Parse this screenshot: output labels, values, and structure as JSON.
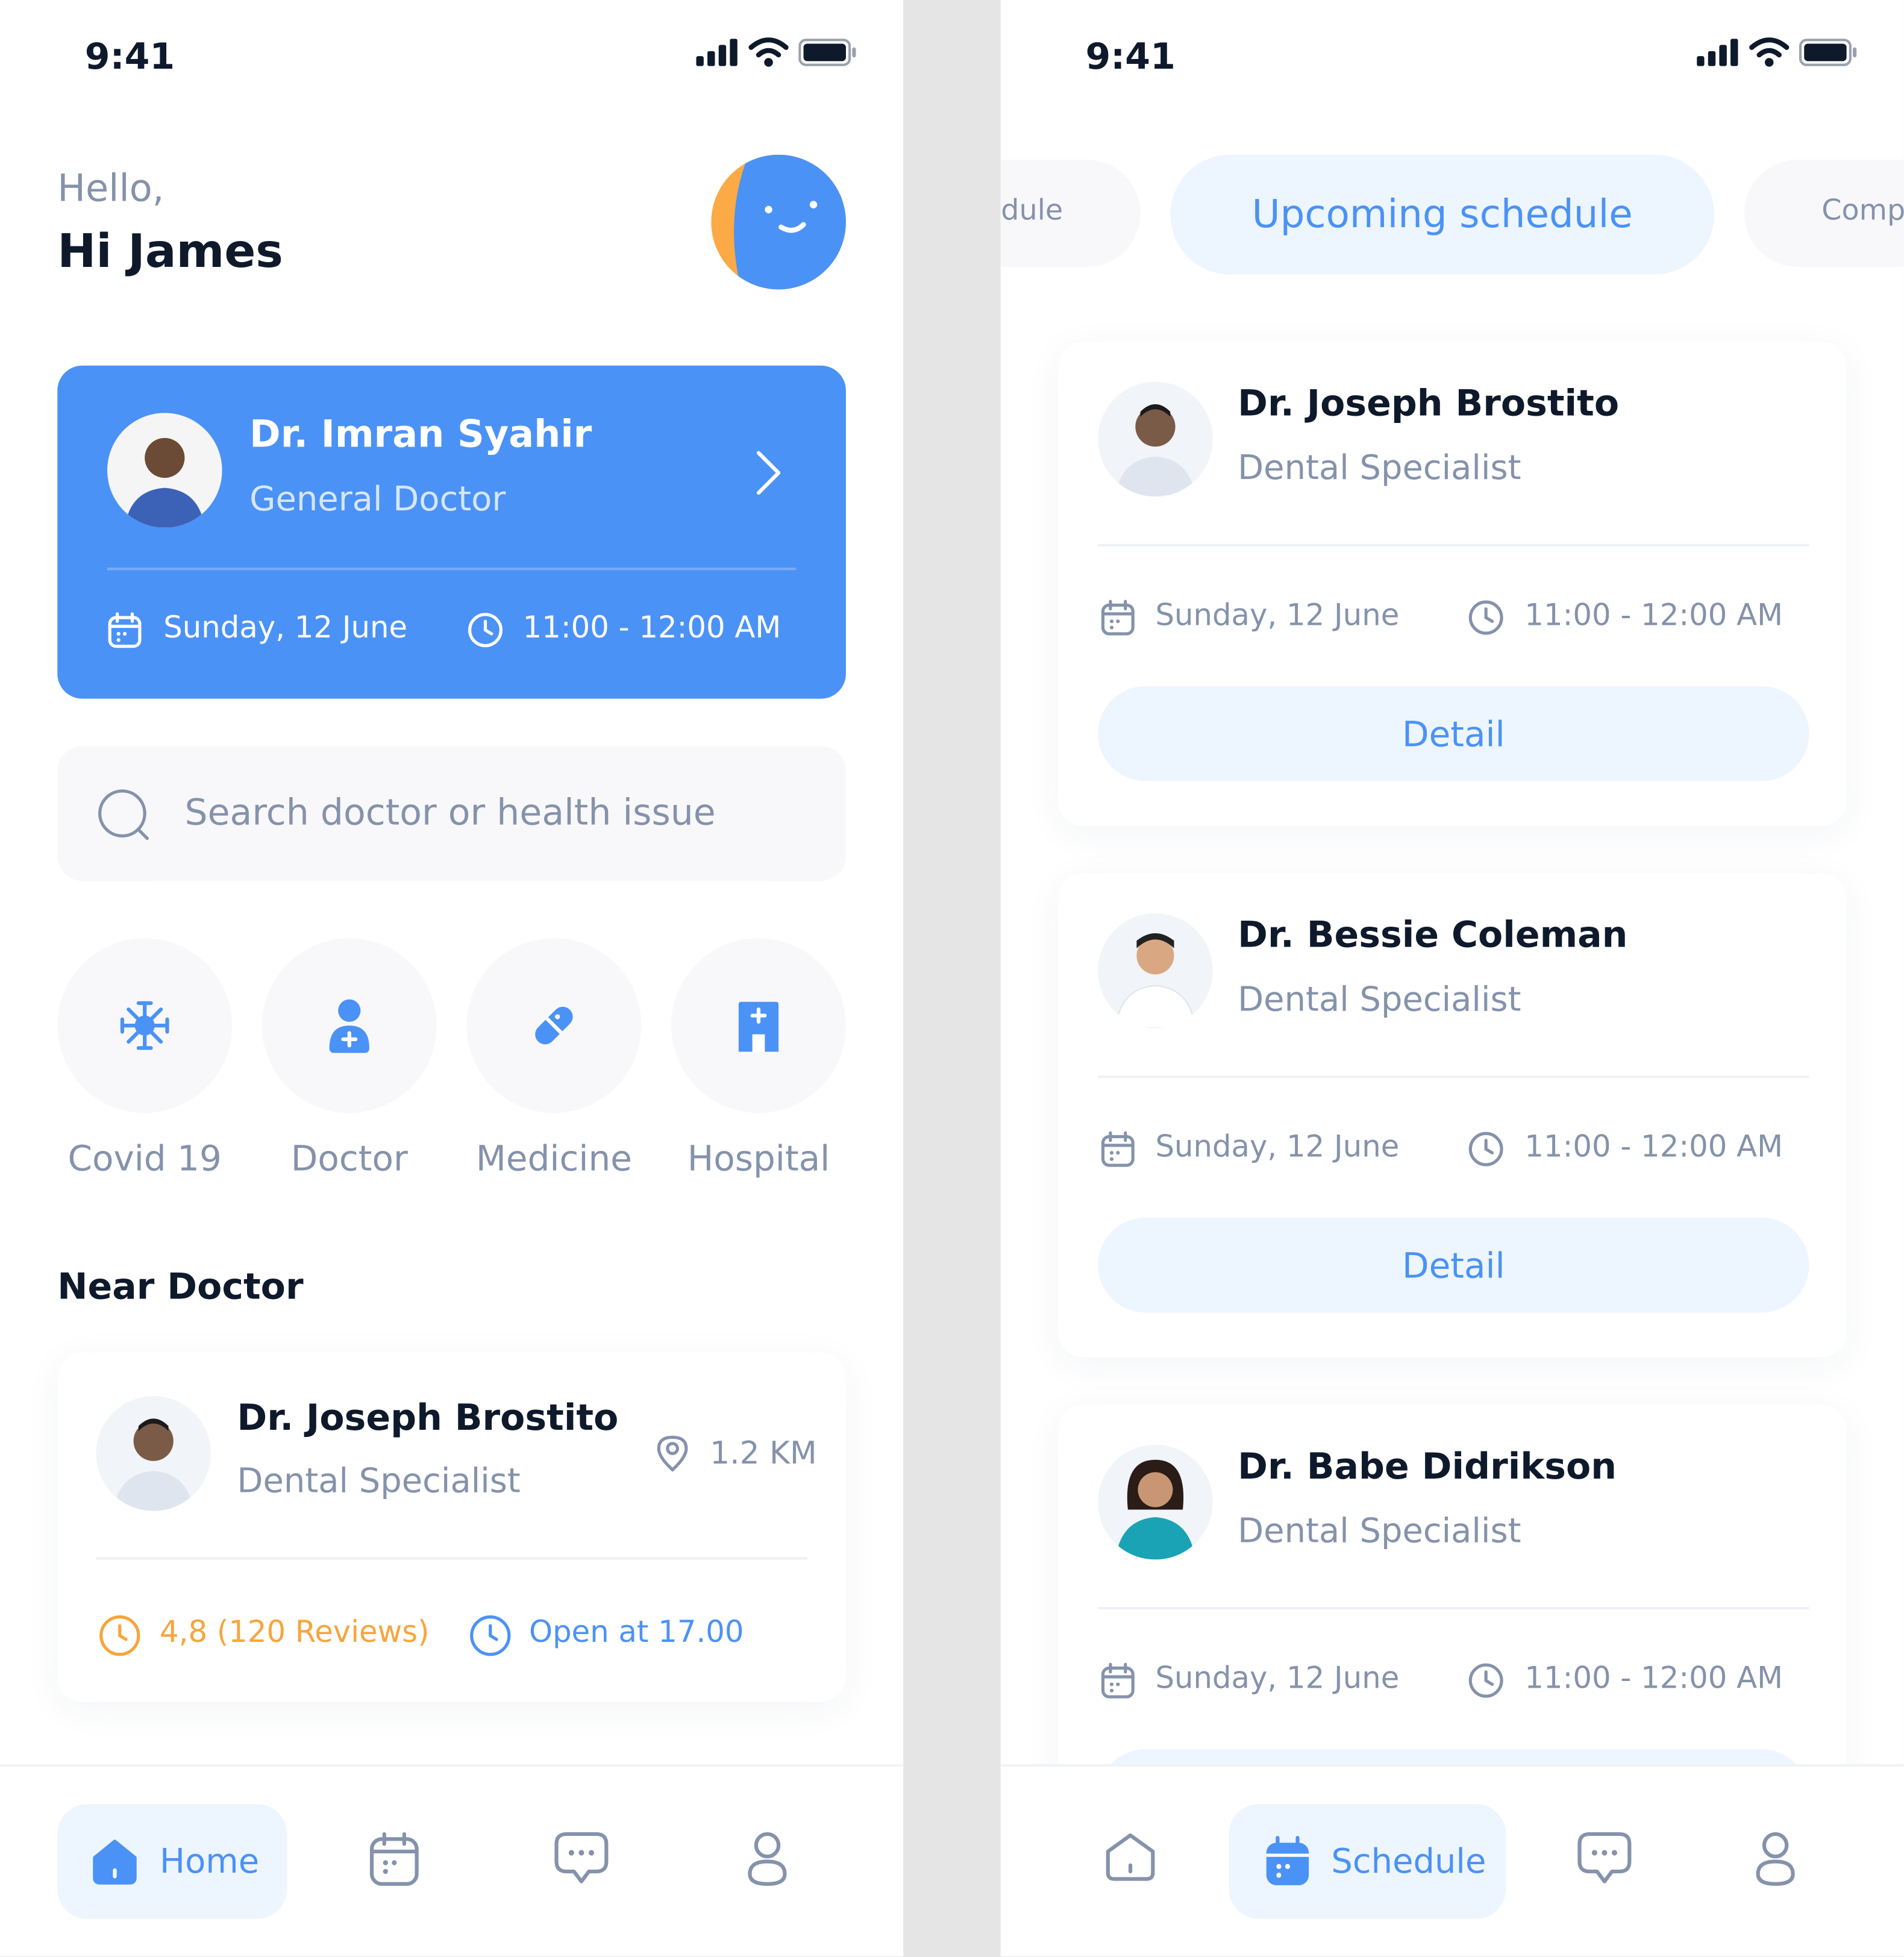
{
  "status_bar": {
    "time": "9:41"
  },
  "home": {
    "greeting": "Hello,",
    "name": "Hi James",
    "appointment": {
      "doctor_name": "Dr. Imran Syahir",
      "specialty": "General Doctor",
      "date": "Sunday, 12 June",
      "time": "11:00 - 12:00 AM"
    },
    "search": {
      "placeholder": "Search doctor or health issue"
    },
    "categories": [
      {
        "label": "Covid 19",
        "icon": "virus-icon"
      },
      {
        "label": "Doctor",
        "icon": "doctor-icon"
      },
      {
        "label": "Medicine",
        "icon": "pill-icon"
      },
      {
        "label": "Hospital",
        "icon": "hospital-icon"
      }
    ],
    "near_title": "Near Doctor",
    "near_doctor": {
      "name": "Dr. Joseph Brostito",
      "specialty": "Dental Specialist",
      "distance": "1.2 KM",
      "rating": "4,8 (120 Reviews)",
      "open": "Open at 17.00"
    },
    "nav": {
      "active_label": "Home"
    }
  },
  "schedule": {
    "tabs": [
      {
        "label": "dule"
      },
      {
        "label": "Upcoming schedule"
      },
      {
        "label": "Comp"
      }
    ],
    "appointments": [
      {
        "name": "Dr. Joseph Brostito",
        "specialty": "Dental Specialist",
        "date": "Sunday, 12 June",
        "time": "11:00 - 12:00 AM",
        "button": "Detail"
      },
      {
        "name": "Dr. Bessie Coleman",
        "specialty": "Dental Specialist",
        "date": "Sunday, 12 June",
        "time": "11:00 - 12:00 AM",
        "button": "Detail"
      },
      {
        "name": "Dr. Babe Didrikson",
        "specialty": "Dental Specialist",
        "date": "Sunday, 12 June",
        "time": "11:00 - 12:00 AM"
      }
    ],
    "nav": {
      "active_label": "Schedule"
    }
  },
  "colors": {
    "primary": "#4b92f6",
    "primary_light": "#edf5ff",
    "dark_text": "#0e1a2b",
    "gray_text": "#8592ab",
    "rating": "#f7a53c",
    "avatar_bg": "#fbaa45"
  }
}
